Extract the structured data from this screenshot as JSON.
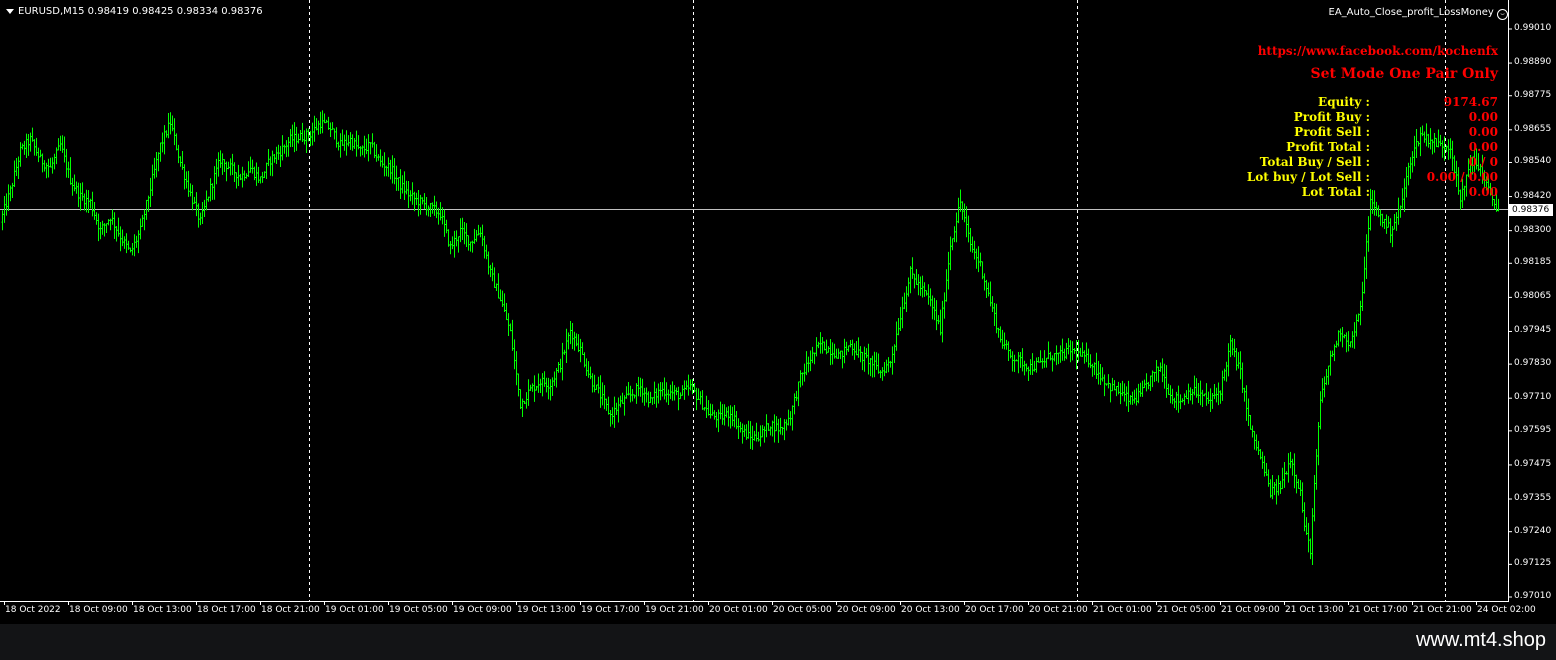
{
  "header": {
    "symbol_info": "EURUSD,M15  0.98419 0.98425 0.98334 0.98376",
    "ea_name": "EA_Auto_Close_profit_LossMoney"
  },
  "panel": {
    "facebook_link": "https://www.facebook.com/kochenfx",
    "mode_text": "Set Mode One Pair Only",
    "rows": [
      {
        "label": "Equity  :",
        "value": "9174.67"
      },
      {
        "label": "Profit Buy  :",
        "value": "0.00"
      },
      {
        "label": "Profit Sell  :",
        "value": "0.00"
      },
      {
        "label": "Profit Total  :",
        "value": "0.00"
      },
      {
        "label": "Total Buy / Sell  :",
        "value": "0 / 0"
      },
      {
        "label": "Lot buy / Lot Sell  :",
        "value": "0.00 / 0.00"
      },
      {
        "label": "Lot Total  :",
        "value": "0.00"
      }
    ]
  },
  "price_axis": {
    "labels": [
      "0.99010",
      "0.98890",
      "0.98775",
      "0.98655",
      "0.98540",
      "0.98420",
      "0.98300",
      "0.98185",
      "0.98065",
      "0.97945",
      "0.97830",
      "0.97710",
      "0.97595",
      "0.97475",
      "0.97355",
      "0.97240",
      "0.97125",
      "0.97010"
    ],
    "current_price": "0.98376"
  },
  "time_axis": {
    "labels": [
      "18 Oct 2022",
      "18 Oct 09:00",
      "18 Oct 13:00",
      "18 Oct 17:00",
      "18 Oct 21:00",
      "19 Oct 01:00",
      "19 Oct 05:00",
      "19 Oct 09:00",
      "19 Oct 13:00",
      "19 Oct 17:00",
      "19 Oct 21:00",
      "20 Oct 01:00",
      "20 Oct 05:00",
      "20 Oct 09:00",
      "20 Oct 13:00",
      "20 Oct 17:00",
      "20 Oct 21:00",
      "21 Oct 01:00",
      "21 Oct 05:00",
      "21 Oct 09:00",
      "21 Oct 13:00",
      "21 Oct 17:00",
      "21 Oct 21:00",
      "24 Oct 02:00"
    ]
  },
  "colors": {
    "background": "#000000",
    "candles": "#00ff00",
    "grid_separator": "#ffffff",
    "panel_labels": "#ffff00",
    "panel_values": "#ff0000"
  },
  "chart_data": {
    "type": "candlestick",
    "symbol": "EURUSD",
    "timeframe": "M15",
    "ylim": [
      0.9701,
      0.9901
    ],
    "anchors": [
      [
        0,
        0.9833
      ],
      [
        10,
        0.9844
      ],
      [
        20,
        0.9858
      ],
      [
        30,
        0.9862
      ],
      [
        40,
        0.9855
      ],
      [
        50,
        0.9852
      ],
      [
        60,
        0.986
      ],
      [
        70,
        0.9848
      ],
      [
        80,
        0.9842
      ],
      [
        90,
        0.984
      ],
      [
        100,
        0.983
      ],
      [
        110,
        0.9835
      ],
      [
        120,
        0.9828
      ],
      [
        130,
        0.9822
      ],
      [
        140,
        0.983
      ],
      [
        150,
        0.9845
      ],
      [
        160,
        0.986
      ],
      [
        170,
        0.9868
      ],
      [
        180,
        0.9854
      ],
      [
        190,
        0.9843
      ],
      [
        200,
        0.9833
      ],
      [
        210,
        0.9845
      ],
      [
        220,
        0.9855
      ],
      [
        230,
        0.9852
      ],
      [
        240,
        0.9849
      ],
      [
        250,
        0.9852
      ],
      [
        260,
        0.9848
      ],
      [
        270,
        0.9855
      ],
      [
        280,
        0.9858
      ],
      [
        290,
        0.9862
      ],
      [
        300,
        0.9863
      ],
      [
        310,
        0.9864
      ],
      [
        320,
        0.9868
      ],
      [
        330,
        0.9866
      ],
      [
        340,
        0.986
      ],
      [
        350,
        0.9862
      ],
      [
        360,
        0.9858
      ],
      [
        370,
        0.986
      ],
      [
        380,
        0.9854
      ],
      [
        390,
        0.9852
      ],
      [
        400,
        0.9846
      ],
      [
        410,
        0.9842
      ],
      [
        420,
        0.984
      ],
      [
        430,
        0.9838
      ],
      [
        440,
        0.9836
      ],
      [
        450,
        0.9824
      ],
      [
        460,
        0.983
      ],
      [
        470,
        0.9826
      ],
      [
        480,
        0.983
      ],
      [
        490,
        0.9815
      ],
      [
        500,
        0.9806
      ],
      [
        510,
        0.9794
      ],
      [
        520,
        0.9769
      ],
      [
        530,
        0.9774
      ],
      [
        540,
        0.9777
      ],
      [
        550,
        0.9776
      ],
      [
        560,
        0.9783
      ],
      [
        570,
        0.9795
      ],
      [
        580,
        0.9788
      ],
      [
        590,
        0.9778
      ],
      [
        600,
        0.9772
      ],
      [
        610,
        0.9765
      ],
      [
        620,
        0.9769
      ],
      [
        630,
        0.9772
      ],
      [
        640,
        0.9775
      ],
      [
        650,
        0.977
      ],
      [
        660,
        0.9774
      ],
      [
        670,
        0.9773
      ],
      [
        680,
        0.9772
      ],
      [
        690,
        0.9775
      ],
      [
        700,
        0.977
      ],
      [
        710,
        0.9765
      ],
      [
        720,
        0.9764
      ],
      [
        730,
        0.9766
      ],
      [
        740,
        0.976
      ],
      [
        750,
        0.9757
      ],
      [
        760,
        0.9758
      ],
      [
        770,
        0.9762
      ],
      [
        780,
        0.976
      ],
      [
        790,
        0.9765
      ],
      [
        800,
        0.9778
      ],
      [
        810,
        0.9785
      ],
      [
        820,
        0.979
      ],
      [
        830,
        0.9788
      ],
      [
        840,
        0.9786
      ],
      [
        850,
        0.979
      ],
      [
        860,
        0.9786
      ],
      [
        870,
        0.9784
      ],
      [
        880,
        0.978
      ],
      [
        890,
        0.9784
      ],
      [
        900,
        0.98
      ],
      [
        910,
        0.9815
      ],
      [
        920,
        0.981
      ],
      [
        930,
        0.9805
      ],
      [
        940,
        0.9795
      ],
      [
        950,
        0.9825
      ],
      [
        960,
        0.984
      ],
      [
        970,
        0.9825
      ],
      [
        980,
        0.9818
      ],
      [
        990,
        0.9805
      ],
      [
        1000,
        0.9792
      ],
      [
        1010,
        0.9786
      ],
      [
        1020,
        0.9784
      ],
      [
        1030,
        0.9782
      ],
      [
        1040,
        0.9783
      ],
      [
        1050,
        0.9786
      ],
      [
        1060,
        0.9786
      ],
      [
        1070,
        0.9788
      ],
      [
        1080,
        0.9786
      ],
      [
        1090,
        0.9784
      ],
      [
        1100,
        0.9779
      ],
      [
        1110,
        0.9775
      ],
      [
        1120,
        0.9773
      ],
      [
        1130,
        0.977
      ],
      [
        1140,
        0.9772
      ],
      [
        1150,
        0.9778
      ],
      [
        1160,
        0.9782
      ],
      [
        1170,
        0.9772
      ],
      [
        1180,
        0.977
      ],
      [
        1190,
        0.9774
      ],
      [
        1200,
        0.9772
      ],
      [
        1210,
        0.977
      ],
      [
        1220,
        0.9774
      ],
      [
        1230,
        0.979
      ],
      [
        1240,
        0.978
      ],
      [
        1250,
        0.976
      ],
      [
        1260,
        0.975
      ],
      [
        1270,
        0.9738
      ],
      [
        1280,
        0.974
      ],
      [
        1290,
        0.975
      ],
      [
        1300,
        0.9738
      ],
      [
        1305,
        0.9723
      ],
      [
        1310,
        0.9718
      ],
      [
        1315,
        0.9745
      ],
      [
        1320,
        0.977
      ],
      [
        1330,
        0.9785
      ],
      [
        1340,
        0.9795
      ],
      [
        1350,
        0.979
      ],
      [
        1360,
        0.9802
      ],
      [
        1370,
        0.984
      ],
      [
        1380,
        0.9835
      ],
      [
        1390,
        0.983
      ],
      [
        1400,
        0.9838
      ],
      [
        1410,
        0.9855
      ],
      [
        1420,
        0.9864
      ],
      [
        1430,
        0.9862
      ],
      [
        1440,
        0.986
      ],
      [
        1450,
        0.986
      ],
      [
        1460,
        0.984
      ],
      [
        1470,
        0.9855
      ],
      [
        1480,
        0.9852
      ],
      [
        1490,
        0.9842
      ],
      [
        1498,
        0.98376
      ]
    ]
  }
}
